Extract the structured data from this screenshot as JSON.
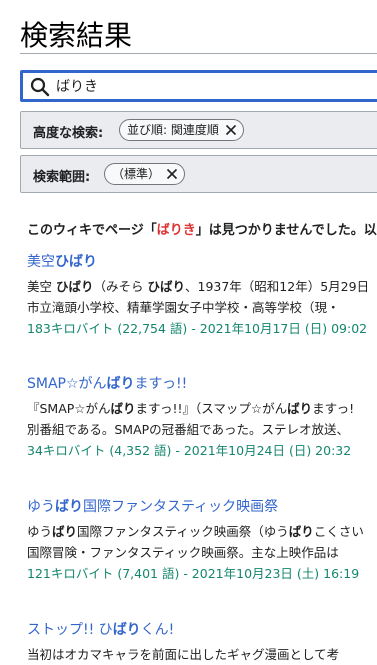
{
  "page": {
    "title": "検索結果"
  },
  "search": {
    "value": "ばりき"
  },
  "advanced": {
    "label": "高度な検索:",
    "chip": "並び順: 関連度順"
  },
  "namespace": {
    "label": "検索範囲:",
    "chip": "（標準）"
  },
  "notice": {
    "before": "このウィキでページ「",
    "term": "ばりき",
    "after": "」は見つかりませんでした。以"
  },
  "results": [
    {
      "title": [
        "美空",
        "ひばり",
        ""
      ],
      "lines": [
        [
          "美空 ",
          "ひばり",
          "（みそら ",
          "ひばり",
          "、1937年（昭和12年）5月29日"
        ],
        [
          "市立滝頭小学校、精華学園女子中学校・高等学校（現・"
        ]
      ],
      "meta": "183キロバイト (22,754 語) - 2021年10月17日 (日) 09:02"
    },
    {
      "title": [
        "SMAP☆がん",
        "ばり",
        "ますっ!!"
      ],
      "lines": [
        [
          "『SMAP☆がん",
          "ばり",
          "ますっ!!』（スマップ☆がん",
          "ばり",
          "ますっ!"
        ],
        [
          "別番組である。SMAPの冠番組であった。ステレオ放送、"
        ]
      ],
      "meta": "34キロバイト (4,352 語) - 2021年10月24日 (日) 20:32"
    },
    {
      "title": [
        "ゆう",
        "ばり",
        "国際ファンタスティック映画祭"
      ],
      "lines": [
        [
          "ゆう",
          "ばり",
          "国際ファンタスティック映画祭（ゆう",
          "ばり",
          "こくさい"
        ],
        [
          "国際冒険・ファンタスティック映画祭。主な上映作品は"
        ]
      ],
      "meta": "121キロバイト (7,401 語) - 2021年10月23日 (土) 16:19"
    },
    {
      "title": [
        "ストップ!! ひ",
        "ばり",
        "くん!"
      ],
      "lines": [
        [
          "当初はオカマキャラを前面に出したギャグ漫画として考"
        ]
      ],
      "meta": ""
    }
  ],
  "icons": {
    "search": "search-icon",
    "remove": "close-icon"
  },
  "colors": {
    "link": "#3366cc",
    "meta": "#14866d",
    "term": "#dd3333",
    "border": "#a2a9b1",
    "focus": "#3366cc"
  }
}
